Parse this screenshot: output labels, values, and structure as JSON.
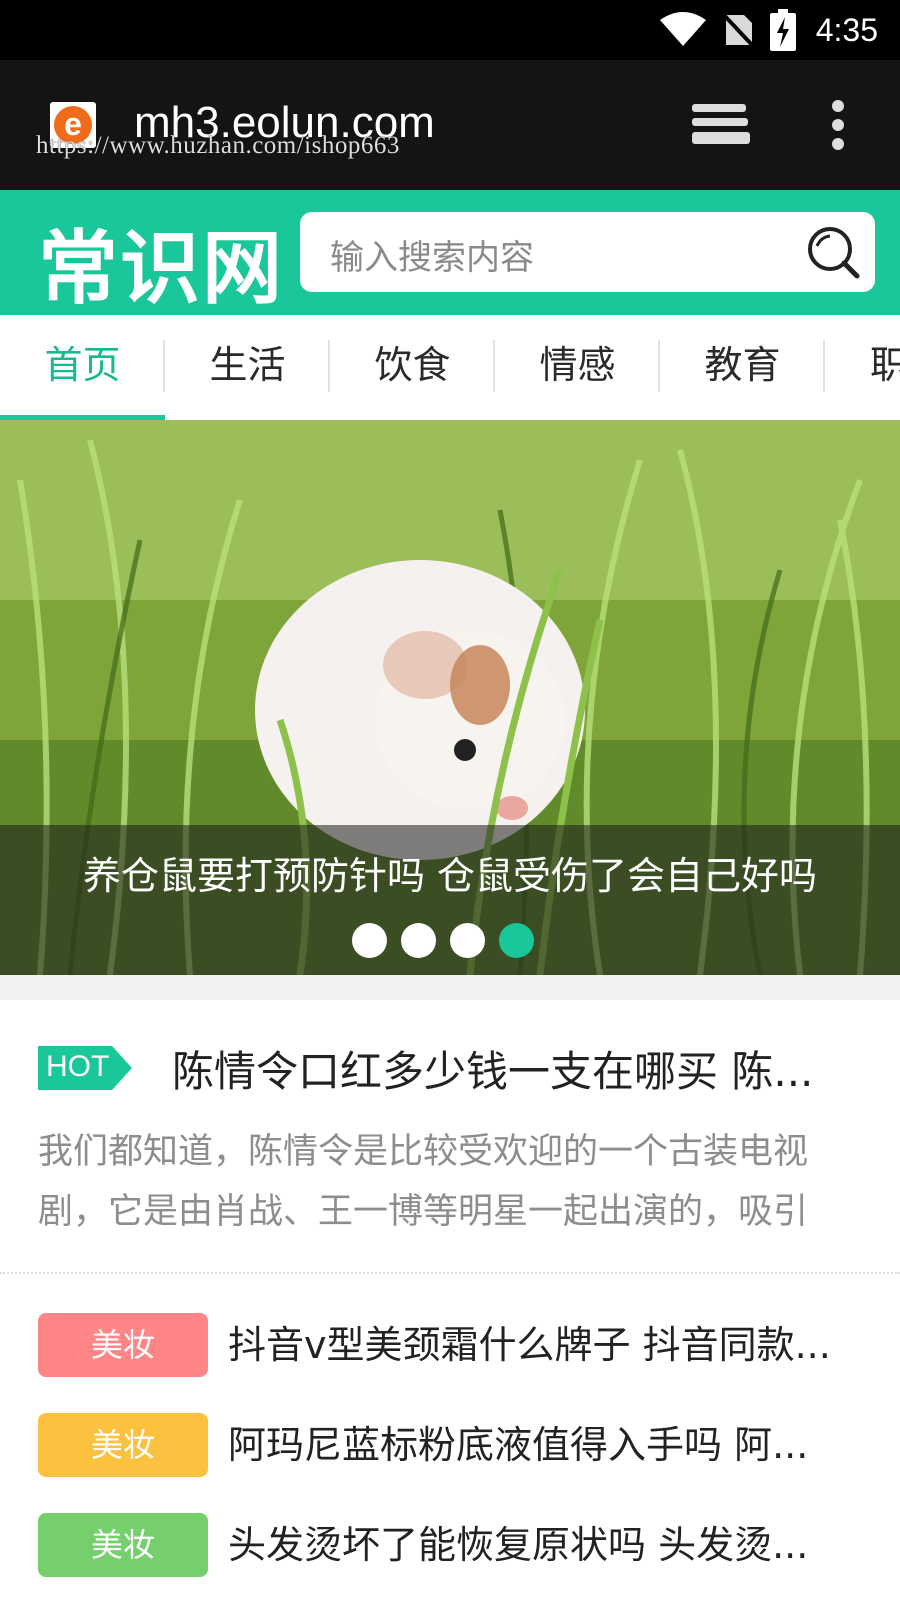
{
  "status_bar": {
    "time": "4:35"
  },
  "browser": {
    "url": "mh3.eolun.com",
    "watermark": "https://www.huzhan.com/ishop663"
  },
  "site": {
    "logo_text": "常识网",
    "search_placeholder": "输入搜索内容"
  },
  "nav": {
    "tabs": [
      {
        "label": "首页",
        "active": true
      },
      {
        "label": "生活",
        "active": false
      },
      {
        "label": "饮食",
        "active": false
      },
      {
        "label": "情感",
        "active": false
      },
      {
        "label": "教育",
        "active": false
      },
      {
        "label": "职",
        "active": false
      }
    ]
  },
  "banner": {
    "caption": "养仓鼠要打预防针吗 仓鼠受伤了会自己好吗",
    "slide_count": 4,
    "active_slide": 4
  },
  "hot": {
    "badge": "HOT",
    "title": "陈情令口红多少钱一支在哪买 陈...",
    "description": "我们都知道，陈情令是比较受欢迎的一个古装电视剧，它是由肖战、王一博等明星一起出演的，吸引"
  },
  "list": [
    {
      "tag": "美妆",
      "tag_color": "#ff8587",
      "title": "抖音v型美颈霜什么牌子 抖音同款..."
    },
    {
      "tag": "美妆",
      "tag_color": "#fcc23f",
      "title": "阿玛尼蓝标粉底液值得入手吗 阿..."
    },
    {
      "tag": "美妆",
      "tag_color": "#76cf6d",
      "title": "头发烫坏了能恢复原状吗 头发烫..."
    }
  ],
  "colors": {
    "accent": "#19c79a",
    "statusbar": "#000000",
    "browserbar": "#141414"
  }
}
